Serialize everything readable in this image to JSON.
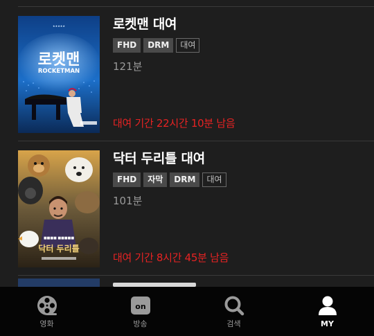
{
  "rentals": [
    {
      "title": "로켓맨 대여",
      "poster_title": "로켓맨",
      "poster_subtitle": "ROCKETMAN",
      "badges": [
        {
          "label": "FHD",
          "style": "solid"
        },
        {
          "label": "DRM",
          "style": "solid"
        },
        {
          "label": "대여",
          "style": "outline"
        }
      ],
      "runtime": "121분",
      "remaining": "대여 기간 22시간 10분 남음"
    },
    {
      "title": "닥터 두리틀 대여",
      "poster_title": "닥터 두리틀",
      "poster_subtitle": "",
      "badges": [
        {
          "label": "FHD",
          "style": "solid"
        },
        {
          "label": "자막",
          "style": "solid"
        },
        {
          "label": "DRM",
          "style": "solid"
        },
        {
          "label": "대여",
          "style": "outline"
        }
      ],
      "runtime": "101분",
      "remaining": "대여 기간 8시간 45분 남음"
    }
  ],
  "tabs": [
    {
      "label": "영화",
      "icon": "film-reel-icon",
      "active": false
    },
    {
      "label": "방송",
      "icon": "on-tv-icon",
      "icon_text": "on",
      "active": false
    },
    {
      "label": "검색",
      "icon": "search-icon",
      "active": false
    },
    {
      "label": "MY",
      "icon": "person-icon",
      "active": true
    }
  ],
  "colors": {
    "background": "#1e1e1e",
    "remaining_text": "#e82323",
    "tabbar": "#050505",
    "badge_solid": "#4a4a4a"
  }
}
